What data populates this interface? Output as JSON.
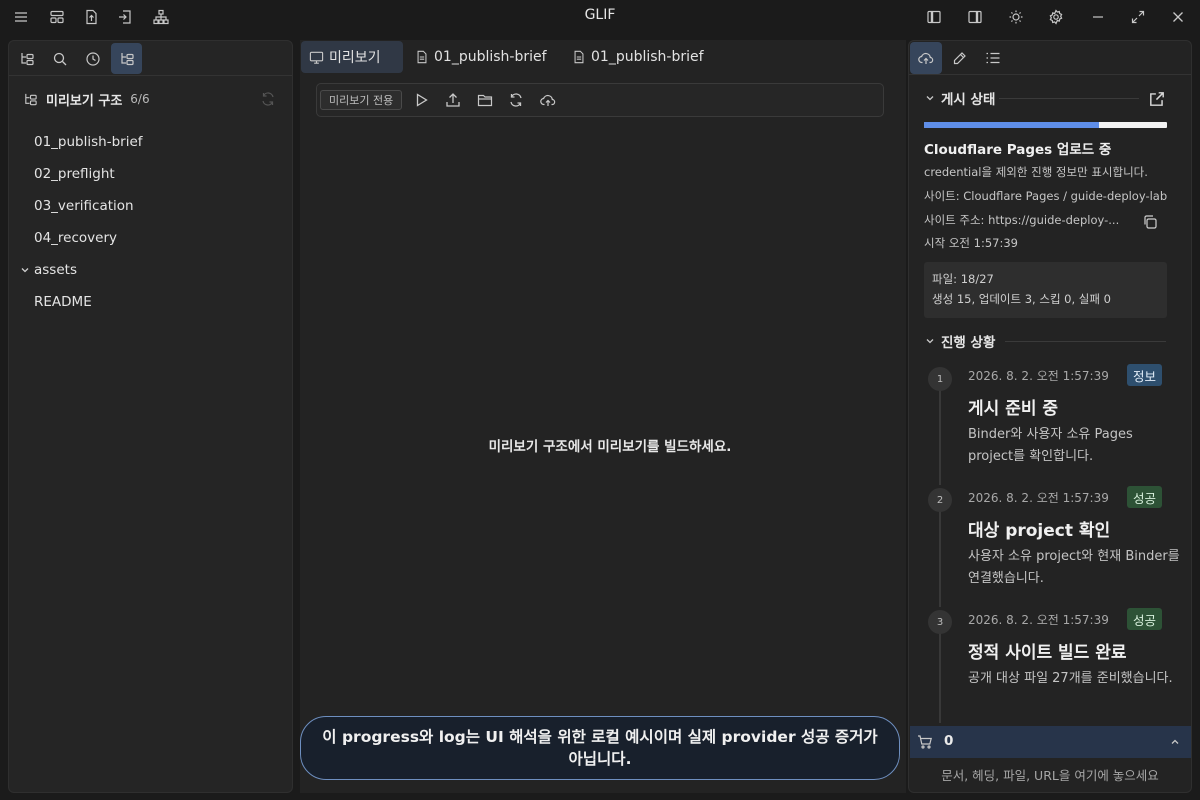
{
  "app": {
    "title": "GLIF"
  },
  "titlebar": {
    "left_icons": [
      "menu-icon",
      "layout-icon",
      "file-export-icon",
      "import-icon",
      "sitemap-icon"
    ],
    "right_icons": [
      "left-sidebar-icon",
      "right-sidebar-icon",
      "sun-icon",
      "gear-icon",
      "minimize-icon",
      "maximize-icon",
      "close-icon"
    ]
  },
  "left_panel": {
    "tab_icons": [
      "tree-icon",
      "search-icon",
      "clock-icon",
      "tree-icon"
    ],
    "active_tab": 3,
    "tree_title": "미리보기 구조",
    "tree_count": "6/6",
    "items": [
      {
        "label": "01_publish-brief"
      },
      {
        "label": "02_preflight"
      },
      {
        "label": "03_verification"
      },
      {
        "label": "04_recovery"
      },
      {
        "label": "assets",
        "expandable": true
      },
      {
        "label": "README"
      }
    ]
  },
  "center": {
    "tabs": [
      {
        "label": "미리보기",
        "icon": "monitor-icon",
        "active": true
      },
      {
        "label": "01_publish-brief",
        "icon": "document-icon"
      },
      {
        "label": "01_publish-brief",
        "icon": "document-icon"
      }
    ],
    "toolbar": {
      "chip": "미리보기 전용",
      "icons": [
        "play-icon",
        "upload-icon",
        "folder-icon",
        "refresh-icon",
        "cloud-upload-icon"
      ]
    },
    "empty_message": "미리보기 구조에서 미리보기를 빌드하세요.",
    "toast": "이 progress와 log는 UI 해석을 위한 로컬 예시이며 실제 provider 성공 증거가 아닙니다."
  },
  "right_panel": {
    "tab_icons": [
      "cloud-upload-icon",
      "edit-icon",
      "list-icon"
    ],
    "publish": {
      "section_title": "게시 상태",
      "progress": 0.72,
      "status_title": "Cloudflare Pages 업로드 중",
      "note": "credential을 제외한 진행 정보만 표시합니다.",
      "site": "사이트: Cloudflare Pages / guide-deploy-lab",
      "site_url": "사이트 주소: https://guide-deploy-...",
      "started": "시작 오전 1:57:39",
      "files": "파일: 18/27",
      "file_stats": "생성 15, 업데이트 3, 스킵 0, 실패 0"
    },
    "progress_section": {
      "title": "진행 상황",
      "steps": [
        {
          "num": "1",
          "time": "2026. 8. 2. 오전 1:57:39",
          "badge": "정보",
          "badge_type": "info",
          "title": "게시 준비 중",
          "desc": "Binder와 사용자 소유 Pages project를 확인합니다."
        },
        {
          "num": "2",
          "time": "2026. 8. 2. 오전 1:57:39",
          "badge": "성공",
          "badge_type": "success",
          "title": "대상 project 확인",
          "desc": "사용자 소유 project와 현재 Binder를 연결했습니다."
        },
        {
          "num": "3",
          "time": "2026. 8. 2. 오전 1:57:39",
          "badge": "성공",
          "badge_type": "success",
          "title": "정적 사이트 빌드 완료",
          "desc": "공개 대상 파일 27개를 준비했습니다."
        }
      ]
    },
    "cart": {
      "count": "0"
    },
    "drop_hint": "문서, 헤딩, 파일, URL을 여기에 놓으세요"
  }
}
